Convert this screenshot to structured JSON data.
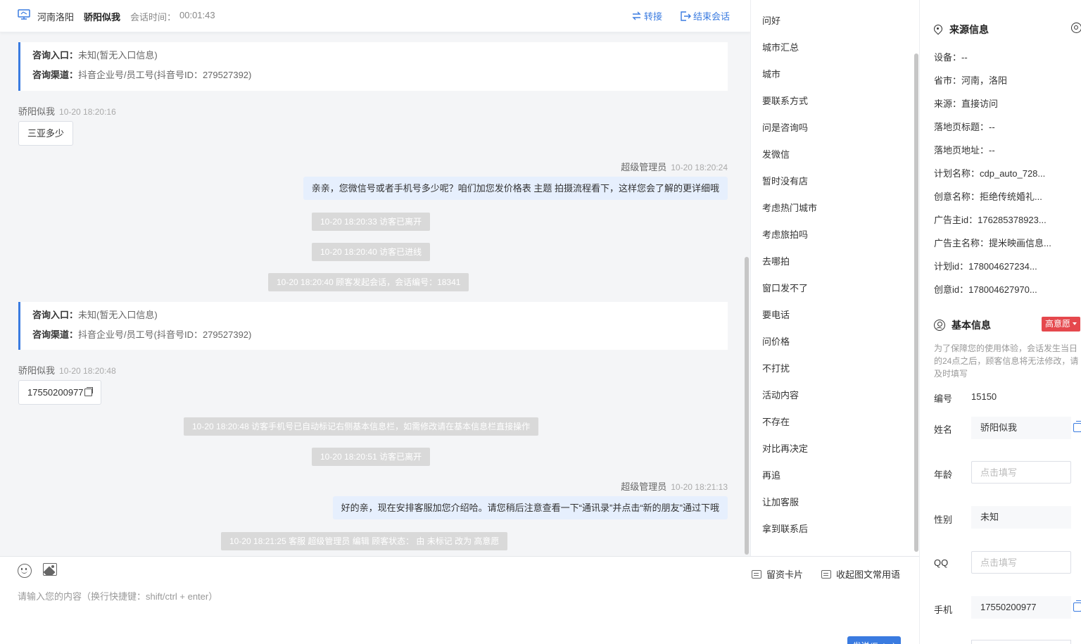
{
  "header": {
    "location": "河南洛阳",
    "visitor_name": "骄阳似我",
    "session_time_label": "会话时间：",
    "session_time": "00:01:43",
    "transfer_label": "转接",
    "end_label": "结束会话"
  },
  "consult_cards": [
    {
      "entry_label": "咨询入口：",
      "entry_value": "未知(暂无入口信息)",
      "channel_label": "咨询渠道：",
      "channel_value": "抖音企业号/员工号(抖音号ID：279527392)"
    },
    {
      "entry_label": "咨询入口：",
      "entry_value": "未知(暂无入口信息)",
      "channel_label": "咨询渠道：",
      "channel_value": "抖音企业号/员工号(抖音号ID：279527392)"
    }
  ],
  "messages": {
    "m1_sender": "骄阳似我",
    "m1_time": "10-20 18:20:16",
    "m1_text": "三亚多少",
    "m2_sender": "超级管理员",
    "m2_time": "10-20 18:20:24",
    "m2_text": "亲亲，您微信号或者手机号多少呢？咱们加您发价格表 主题 拍摄流程看下，这样您会了解的更详细哦",
    "s1": "10-20 18:20:33 访客已离开",
    "s2": "10-20 18:20:40 访客已进线",
    "s3": "10-20 18:20:40 顾客发起会话，会话编号：18341",
    "m3_sender": "骄阳似我",
    "m3_time": "10-20 18:20:48",
    "m3_text": "17550200977",
    "s4": "10-20 18:20:48 访客手机号已自动标记右侧基本信息栏，如需修改请在基本信息栏直接操作",
    "s5": "10-20 18:20:51 访客已离开",
    "m4_sender": "超级管理员",
    "m4_time": "10-20 18:21:13",
    "m4_text": "好的亲，现在安排客服加您介绍哈。请您稍后注意查看一下“通讯录”并点击“新的朋友”通过下哦",
    "s6": "10-20 18:21:25 客服 超级管理员 编辑 顾客状态： 由 未标记 改为 高意愿"
  },
  "phrases": [
    "问好",
    "城市汇总",
    "城市",
    "要联系方式",
    "问是咨询吗",
    "发微信",
    "暂时没有店",
    "考虑热门城市",
    "考虑旅拍吗",
    "去哪拍",
    "窗口发不了",
    "要电话",
    "问价格",
    "不打扰",
    "活动内容",
    "不存在",
    "对比再决定",
    "再追",
    "让加客服",
    "拿到联系后"
  ],
  "composer": {
    "placeholder": "请输入您的内容（换行快捷键：shift/ctrl + enter）",
    "card_label": "留资卡片",
    "phrase_label": "收起图文常用语",
    "send_label": "发送(Enter)"
  },
  "source_info": {
    "title": "来源信息",
    "rows": [
      "设备：--",
      "省市：河南，洛阳",
      "来源：直接访问",
      "落地页标题：--",
      "落地页地址：--",
      "计划名称：cdp_auto_728...",
      "创意名称：拒绝传统婚礼...",
      "广告主id：176285378923...",
      "广告主名称：提米映画信息...",
      "计划id：178004627234...",
      "创意id：178004627970..."
    ]
  },
  "basic_info": {
    "title": "基本信息",
    "intent_tag": "高意愿",
    "intent_color": "#e5484d",
    "notice": "为了保障您的使用体验，会话发生当日的24点之后，顾客信息将无法修改，请及时填写",
    "id_label": "编号",
    "id_value": "15150",
    "name_label": "姓名",
    "name_value": "骄阳似我",
    "age_label": "年龄",
    "age_placeholder": "点击填写",
    "gender_label": "性别",
    "gender_value": "未知",
    "qq_label": "QQ",
    "qq_placeholder": "点击填写",
    "phone_label": "手机",
    "phone_value": "17550200977"
  },
  "colors": {
    "accent": "#3a7be0",
    "out_bubble": "#e6effd",
    "system_msg": "#d9d9d9"
  }
}
